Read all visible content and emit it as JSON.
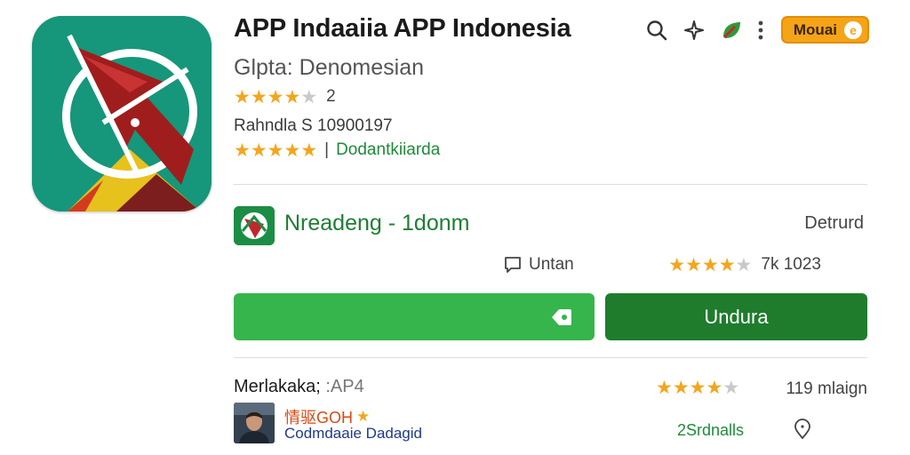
{
  "app": {
    "title": "APP Indaaiia APP Indonesia",
    "developer": "Glpta: Denomesian",
    "rating_count": "2",
    "subtext": "Rahndla S 10900197",
    "editor_label": "Dodantkiiarda",
    "rating_stars": 4,
    "editor_stars": 5
  },
  "top_actions": {
    "icons": [
      "search-icon",
      "sparkle-icon",
      "leaf-icon",
      "more-vert-icon"
    ],
    "badge_label": "Mouai",
    "badge_icon_glyph": "e"
  },
  "related": {
    "title": "Nreadeng  - 1donm",
    "right_label": "Detrurd",
    "reply_label": "Untan",
    "rating_stars": 4,
    "rating_text": "7k  1023"
  },
  "buttons": {
    "wide_icon": "tag-icon",
    "install_label": "Undura"
  },
  "reviews": {
    "section_title": "Merlakaka;",
    "section_title_suffix": ":AP4",
    "rating_stars": 4,
    "count": "119 mlaign",
    "item": {
      "name": "情驱GOH",
      "subtitle": "Codmdaaie Dadagid",
      "right_text": "2Srdnalls"
    }
  },
  "colors": {
    "green": "#35b54c",
    "dark_green": "#1f7c2d",
    "star": "#f4a51c",
    "badge": "#f5a417",
    "icon_bg": "#16967a",
    "icon_red": "#a01d1d"
  }
}
